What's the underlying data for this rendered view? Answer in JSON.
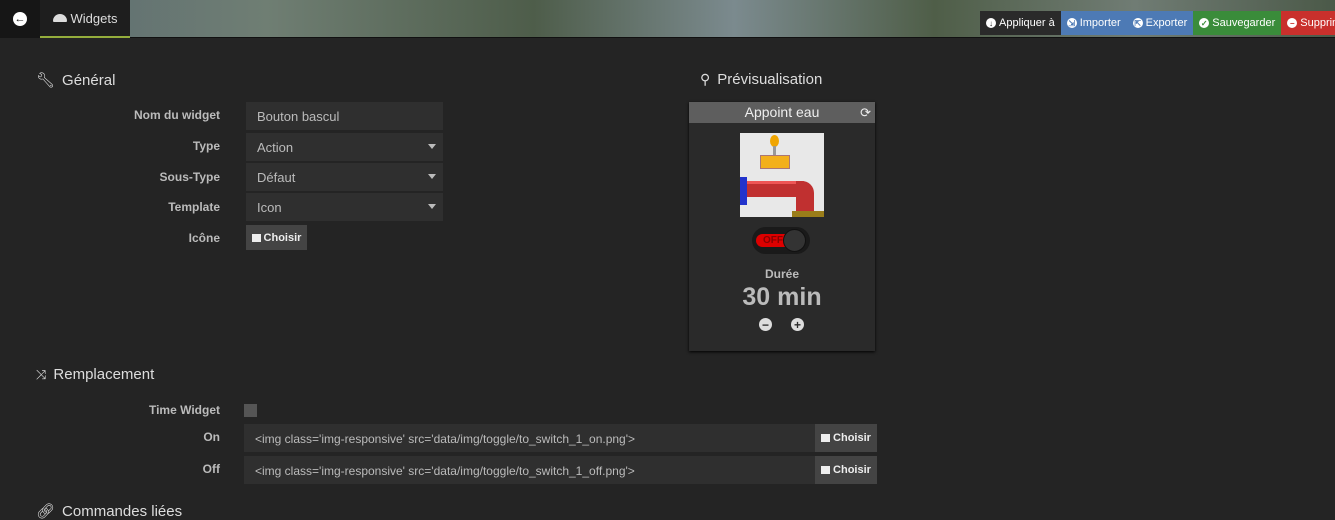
{
  "header": {
    "tab_label": "Widgets",
    "actions": [
      {
        "label": "Appliquer à",
        "color": "#2a2a2a",
        "icon": "arrow-circle-down-icon"
      },
      {
        "label": "Importer",
        "color": "#4d7ab5",
        "icon": "file-import-icon"
      },
      {
        "label": "Exporter",
        "color": "#4d7ab5",
        "icon": "file-export-icon"
      },
      {
        "label": "Sauvegarder",
        "color": "#3a8c3a",
        "icon": "check-circle-icon"
      },
      {
        "label": "Supprimer",
        "color": "#c9302c",
        "icon": "minus-circle-icon"
      }
    ]
  },
  "general": {
    "title": "Général",
    "fields": [
      {
        "label": "Nom du widget",
        "value": "Bouton bascul"
      },
      {
        "label": "Type",
        "value": "Action"
      },
      {
        "label": "Sous-Type",
        "value": "Défaut"
      },
      {
        "label": "Template",
        "value": "Icon"
      }
    ],
    "icon_label": "Icône",
    "choose_label": "Choisir"
  },
  "preview": {
    "title": "Prévisualisation",
    "widget_name": "Appoint eau",
    "toggle_label": "OFF",
    "duration_label": "Durée",
    "duration_value": "30 min"
  },
  "replacement": {
    "title": "Remplacement",
    "time_widget_label": "Time Widget",
    "time_widget_checked": false,
    "on_label": "On",
    "on_value": "<img class='img-responsive' src='data/img/toggle/to_switch_1_on.png'>",
    "off_label": "Off",
    "off_value": "<img class='img-responsive' src='data/img/toggle/to_switch_1_off.png'>",
    "choose_label": "Choisir"
  },
  "linked": {
    "title": "Commandes liées"
  }
}
